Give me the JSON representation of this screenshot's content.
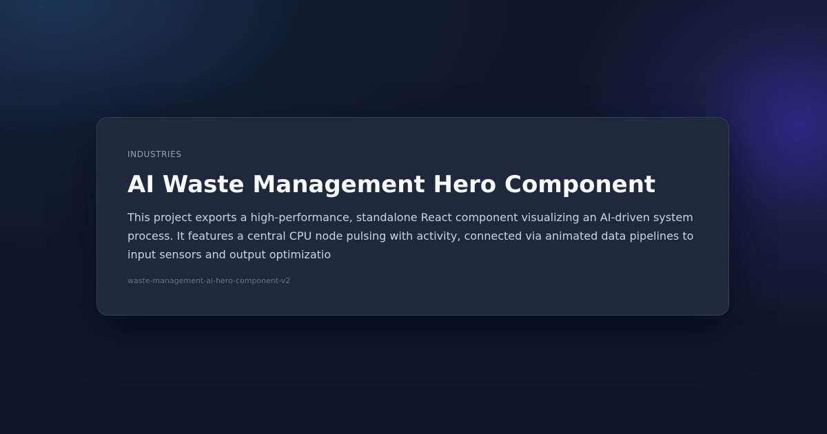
{
  "card": {
    "category": "INDUSTRIES",
    "title": "AI Waste Management Hero Component",
    "description": "This project exports a high-performance, standalone React component visualizing an AI-driven system process. It features a central CPU node pulsing with activity, connected via animated data pipelines to input sensors and output optimizatio",
    "slug": "waste-management-ai-hero-component-v2"
  },
  "colors": {
    "background": "#0f172a",
    "card_background": "#1e293b",
    "card_border": "#334155",
    "title": "#f8fafc",
    "description": "#cbd5e1",
    "eyebrow": "#94a3b8",
    "slug": "#64748b",
    "glow_accent": "#4338ca"
  }
}
